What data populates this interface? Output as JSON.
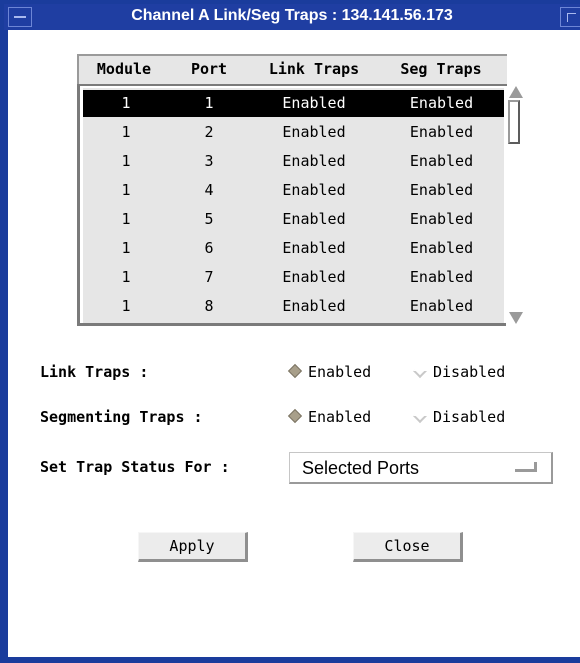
{
  "window": {
    "title": "Channel A Link/Seg Traps : 134.141.56.173"
  },
  "table": {
    "columns": [
      "Module",
      "Port",
      "Link Traps",
      "Seg Traps"
    ],
    "rows": [
      [
        "1",
        "1",
        "Enabled",
        "Enabled"
      ],
      [
        "1",
        "2",
        "Enabled",
        "Enabled"
      ],
      [
        "1",
        "3",
        "Enabled",
        "Enabled"
      ],
      [
        "1",
        "4",
        "Enabled",
        "Enabled"
      ],
      [
        "1",
        "5",
        "Enabled",
        "Enabled"
      ],
      [
        "1",
        "6",
        "Enabled",
        "Enabled"
      ],
      [
        "1",
        "7",
        "Enabled",
        "Enabled"
      ],
      [
        "1",
        "8",
        "Enabled",
        "Enabled"
      ]
    ],
    "selected_row": 0
  },
  "link_traps": {
    "label": "Link Traps :",
    "enabled": "Enabled",
    "disabled": "Disabled",
    "selected": "Enabled"
  },
  "seg_traps": {
    "label": "Segmenting Traps :",
    "enabled": "Enabled",
    "disabled": "Disabled",
    "selected": "Enabled"
  },
  "trap_status": {
    "label": "Set Trap Status For :",
    "value": "Selected Ports"
  },
  "buttons": {
    "apply": "Apply",
    "close": "Close"
  },
  "colors": {
    "title_bar": "#1f3ea2",
    "selection": "#000000",
    "list_bg": "#e6e6e6"
  }
}
